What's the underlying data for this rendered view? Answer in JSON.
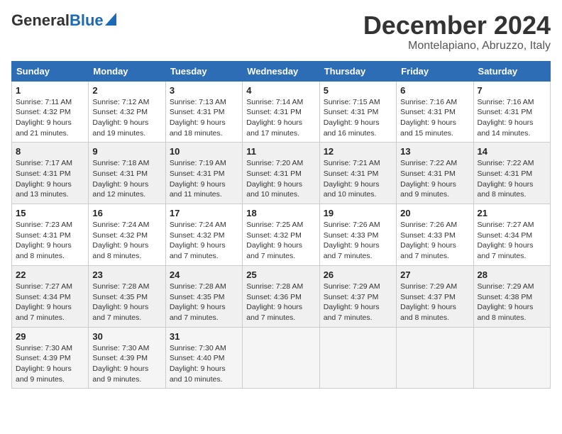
{
  "header": {
    "logo_general": "General",
    "logo_blue": "Blue",
    "month_title": "December 2024",
    "location": "Montelapiano, Abruzzo, Italy"
  },
  "weekdays": [
    "Sunday",
    "Monday",
    "Tuesday",
    "Wednesday",
    "Thursday",
    "Friday",
    "Saturday"
  ],
  "weeks": [
    [
      {
        "day": "1",
        "sunrise": "7:11 AM",
        "sunset": "4:32 PM",
        "daylight": "9 hours and 21 minutes."
      },
      {
        "day": "2",
        "sunrise": "7:12 AM",
        "sunset": "4:32 PM",
        "daylight": "9 hours and 19 minutes."
      },
      {
        "day": "3",
        "sunrise": "7:13 AM",
        "sunset": "4:31 PM",
        "daylight": "9 hours and 18 minutes."
      },
      {
        "day": "4",
        "sunrise": "7:14 AM",
        "sunset": "4:31 PM",
        "daylight": "9 hours and 17 minutes."
      },
      {
        "day": "5",
        "sunrise": "7:15 AM",
        "sunset": "4:31 PM",
        "daylight": "9 hours and 16 minutes."
      },
      {
        "day": "6",
        "sunrise": "7:16 AM",
        "sunset": "4:31 PM",
        "daylight": "9 hours and 15 minutes."
      },
      {
        "day": "7",
        "sunrise": "7:16 AM",
        "sunset": "4:31 PM",
        "daylight": "9 hours and 14 minutes."
      }
    ],
    [
      {
        "day": "8",
        "sunrise": "7:17 AM",
        "sunset": "4:31 PM",
        "daylight": "9 hours and 13 minutes."
      },
      {
        "day": "9",
        "sunrise": "7:18 AM",
        "sunset": "4:31 PM",
        "daylight": "9 hours and 12 minutes."
      },
      {
        "day": "10",
        "sunrise": "7:19 AM",
        "sunset": "4:31 PM",
        "daylight": "9 hours and 11 minutes."
      },
      {
        "day": "11",
        "sunrise": "7:20 AM",
        "sunset": "4:31 PM",
        "daylight": "9 hours and 10 minutes."
      },
      {
        "day": "12",
        "sunrise": "7:21 AM",
        "sunset": "4:31 PM",
        "daylight": "9 hours and 10 minutes."
      },
      {
        "day": "13",
        "sunrise": "7:22 AM",
        "sunset": "4:31 PM",
        "daylight": "9 hours and 9 minutes."
      },
      {
        "day": "14",
        "sunrise": "7:22 AM",
        "sunset": "4:31 PM",
        "daylight": "9 hours and 8 minutes."
      }
    ],
    [
      {
        "day": "15",
        "sunrise": "7:23 AM",
        "sunset": "4:31 PM",
        "daylight": "9 hours and 8 minutes."
      },
      {
        "day": "16",
        "sunrise": "7:24 AM",
        "sunset": "4:32 PM",
        "daylight": "9 hours and 8 minutes."
      },
      {
        "day": "17",
        "sunrise": "7:24 AM",
        "sunset": "4:32 PM",
        "daylight": "9 hours and 7 minutes."
      },
      {
        "day": "18",
        "sunrise": "7:25 AM",
        "sunset": "4:32 PM",
        "daylight": "9 hours and 7 minutes."
      },
      {
        "day": "19",
        "sunrise": "7:26 AM",
        "sunset": "4:33 PM",
        "daylight": "9 hours and 7 minutes."
      },
      {
        "day": "20",
        "sunrise": "7:26 AM",
        "sunset": "4:33 PM",
        "daylight": "9 hours and 7 minutes."
      },
      {
        "day": "21",
        "sunrise": "7:27 AM",
        "sunset": "4:34 PM",
        "daylight": "9 hours and 7 minutes."
      }
    ],
    [
      {
        "day": "22",
        "sunrise": "7:27 AM",
        "sunset": "4:34 PM",
        "daylight": "9 hours and 7 minutes."
      },
      {
        "day": "23",
        "sunrise": "7:28 AM",
        "sunset": "4:35 PM",
        "daylight": "9 hours and 7 minutes."
      },
      {
        "day": "24",
        "sunrise": "7:28 AM",
        "sunset": "4:35 PM",
        "daylight": "9 hours and 7 minutes."
      },
      {
        "day": "25",
        "sunrise": "7:28 AM",
        "sunset": "4:36 PM",
        "daylight": "9 hours and 7 minutes."
      },
      {
        "day": "26",
        "sunrise": "7:29 AM",
        "sunset": "4:37 PM",
        "daylight": "9 hours and 7 minutes."
      },
      {
        "day": "27",
        "sunrise": "7:29 AM",
        "sunset": "4:37 PM",
        "daylight": "9 hours and 8 minutes."
      },
      {
        "day": "28",
        "sunrise": "7:29 AM",
        "sunset": "4:38 PM",
        "daylight": "9 hours and 8 minutes."
      }
    ],
    [
      {
        "day": "29",
        "sunrise": "7:30 AM",
        "sunset": "4:39 PM",
        "daylight": "9 hours and 9 minutes."
      },
      {
        "day": "30",
        "sunrise": "7:30 AM",
        "sunset": "4:39 PM",
        "daylight": "9 hours and 9 minutes."
      },
      {
        "day": "31",
        "sunrise": "7:30 AM",
        "sunset": "4:40 PM",
        "daylight": "9 hours and 10 minutes."
      },
      null,
      null,
      null,
      null
    ]
  ],
  "labels": {
    "sunrise": "Sunrise:",
    "sunset": "Sunset:",
    "daylight": "Daylight:"
  }
}
